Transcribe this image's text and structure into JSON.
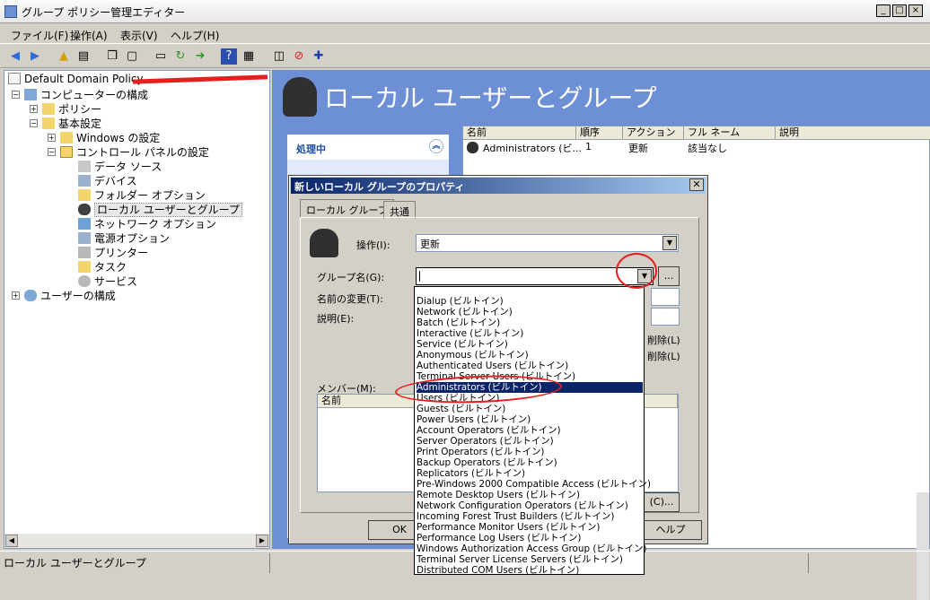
{
  "window": {
    "title": "グループ ポリシー管理エディター",
    "buttons": [
      "_",
      "□",
      "×"
    ]
  },
  "menu": [
    "ファイル(F)",
    "操作(A)",
    "表示(V)",
    "ヘルプ(H)"
  ],
  "toolbar_icons": [
    "back-icon",
    "forward-icon",
    "up-folder-icon",
    "show-hide-tree-icon",
    "copy-icon",
    "paste-icon",
    "print-icon",
    "refresh-icon",
    "export-icon",
    "help-icon",
    "properties-icon",
    "new-item-icon",
    "stop-icon",
    "add-icon"
  ],
  "tree": {
    "root": "Default Domain Policy",
    "computer_config": "コンピューターの構成",
    "policy": "ポリシー",
    "preferences": "基本設定",
    "windows_settings": "Windows の設定",
    "control_panel": "コントロール パネルの設定",
    "data_sources": "データ ソース",
    "devices": "デバイス",
    "folder_options": "フォルダー オプション",
    "local_users": "ローカル ユーザーとグループ",
    "network_options": "ネットワーク オプション",
    "power_options": "電源オプション",
    "printers": "プリンター",
    "tasks": "タスク",
    "services": "サービス",
    "user_config": "ユーザーの構成"
  },
  "right": {
    "title": "ローカル ユーザーとグループ",
    "taskpane_header": "処理中",
    "columns": [
      "名前",
      "順序",
      "アクション",
      "フル ネーム",
      "説明"
    ],
    "row": {
      "name": "Administrators (ビ...",
      "order": "1",
      "action": "更新",
      "fullname": "該当なし",
      "desc": ""
    }
  },
  "status": "ローカル ユーザーとグループ",
  "dialog": {
    "title": "新しいローカル グループのプロパティ",
    "tabs": [
      "ローカル グループ",
      "共通"
    ],
    "action_label": "操作(I):",
    "action_value": "更新",
    "group_name_label": "グループ名(G):",
    "group_name_value": "",
    "browse": "...",
    "rename_label": "名前の変更(T):",
    "desc_label": "説明(E):",
    "delete_label_1": "削除(L)",
    "delete_label_2": "削除(L)",
    "members_label": "メンバー(M):",
    "members_col": "名前",
    "ok": "OK",
    "help": "ヘルプ",
    "remove_partial": "(C)..."
  },
  "dropdown": [
    "Dialup (ビルトイン)",
    "Network (ビルトイン)",
    "Batch (ビルトイン)",
    "Interactive (ビルトイン)",
    "Service (ビルトイン)",
    "Anonymous (ビルトイン)",
    "Authenticated Users (ビルトイン)",
    "Terminal Server Users (ビルトイン)",
    "Administrators (ビルトイン)",
    "Users (ビルトイン)",
    "Guests (ビルトイン)",
    "Power Users (ビルトイン)",
    "Account Operators (ビルトイン)",
    "Server Operators (ビルトイン)",
    "Print Operators (ビルトイン)",
    "Backup Operators (ビルトイン)",
    "Replicators (ビルトイン)",
    "Pre-Windows 2000 Compatible Access (ビルトイン)",
    "Remote Desktop Users (ビルトイン)",
    "Network Configuration Operators (ビルトイン)",
    "Incoming Forest Trust Builders (ビルトイン)",
    "Performance Monitor Users (ビルトイン)",
    "Performance Log Users (ビルトイン)",
    "Windows Authorization Access Group (ビルトイン)",
    "Terminal Server License Servers (ビルトイン)",
    "Distributed COM Users (ビルトイン)"
  ],
  "dropdown_selected_index": 8,
  "colors": {
    "accent": "#0a246a",
    "panel_blue": "#6d8fd6",
    "annotation_red": "#e51e1e"
  }
}
